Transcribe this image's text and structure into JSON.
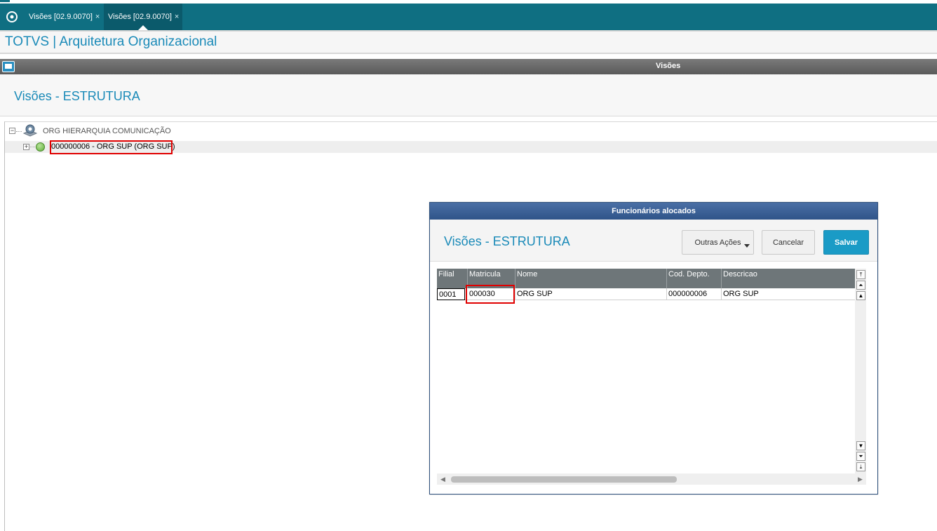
{
  "tabs": [
    {
      "label": "Visões [02.9.0070]",
      "close": "×"
    },
    {
      "label": "Visões [02.9.0070]",
      "close": "×"
    }
  ],
  "app": {
    "title": "TOTVS | Arquitetura Organizacional"
  },
  "window": {
    "title": "Visões"
  },
  "page": {
    "title": "Visões - ESTRUTURA"
  },
  "tree": {
    "root": {
      "label": "ORG HIERARQUIA COMUNICAÇÃO",
      "expander": "−"
    },
    "child": {
      "label": "000000006 - ORG SUP (ORG SUP)",
      "expander": "+"
    }
  },
  "dialog": {
    "title": "Funcionários alocados",
    "heading": "Visões - ESTRUTURA",
    "buttons": {
      "outras": "Outras Ações",
      "cancelar": "Cancelar",
      "salvar": "Salvar"
    },
    "grid": {
      "columns": [
        "Filial",
        "Matricula",
        "Nome",
        "Cod. Depto.",
        "Descricao"
      ],
      "rows": [
        [
          "0001",
          "000030",
          "ORG SUP",
          "000000006",
          "ORG SUP"
        ]
      ]
    }
  },
  "colors": {
    "accent": "#1a8ab8",
    "tabbar": "#0f6f82",
    "highlight": "#e00000",
    "primary_button": "#1a9bc6"
  }
}
